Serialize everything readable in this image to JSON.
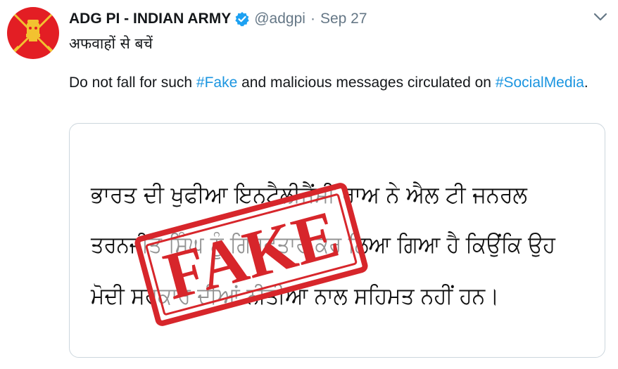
{
  "account": {
    "name": "ADG PI - INDIAN ARMY",
    "handle": "@adgpi",
    "separator": "·",
    "date": "Sep 27",
    "avatar_icon": "indian-army-emblem",
    "verified_icon": "verified-badge-icon",
    "verified_color": "#1da1f2"
  },
  "tweet": {
    "hindi_line": "अफवाहों से बचें",
    "text_before": "Do not fall for such ",
    "hashtag1": "#Fake",
    "text_middle": " and malicious messages circulated on ",
    "hashtag2": "#SocialMedia",
    "text_end": ".",
    "hashtag_color": "#1b95e0"
  },
  "media": {
    "punjabi_lines": [
      "ਭਾਰਤ ਦੀ ਖੁਫੀਆ ਇਨਟੈਲੀਜੈਂਸੀ ਰਾਅ ਨੇ ਐਲ ਟੀ ਜਨਰਲ",
      "ਤਰਨਜੀਤ ਸਿੰਘ ਨੂੰ ਗਿਰਫ਼ਤਾਰ ਕਰ ਲਿਆ ਗਿਆ ਹੈ ਕਿਉਂਕਿ ਉਹ",
      "ਮੋਦੀ ਸਰਕਾਰ ਦੀਆਂ ਨੀਤੀਆਂ ਨਾਲ ਸਹਿਮਤ ਨਹੀਂ ਹਨ।"
    ],
    "stamp_text": "FAKE",
    "stamp_color": "#d7262b"
  }
}
